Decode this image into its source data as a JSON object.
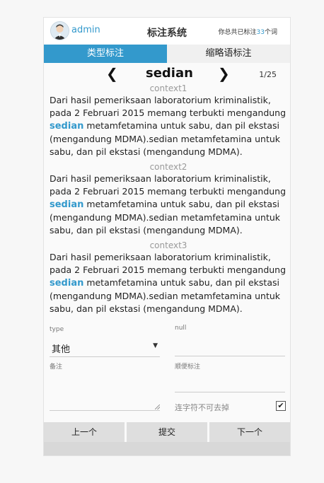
{
  "header": {
    "user": "admin",
    "title": "标注系统",
    "count_prefix": "你总共已标注",
    "count": "33",
    "count_suffix": "个词"
  },
  "tabs": [
    {
      "label": "类型标注",
      "active": true
    },
    {
      "label": "缩略语标注",
      "active": false
    }
  ],
  "word_nav": {
    "prev_icon": "chevron-left-icon",
    "next_icon": "chevron-right-icon",
    "word": "sedian",
    "page": "1/25"
  },
  "contexts": [
    {
      "label": "context1",
      "before": "Dari hasil pemeriksaan laboratorium kriminalistik, pada 2 Februari 2015 memang terbukti mengandung ",
      "highlight": "sedian",
      "after": " metamfetamina untuk sabu, dan pil ekstasi (mengandung MDMA).sedian metamfetamina untuk sabu, dan pil ekstasi (mengandung MDMA)."
    },
    {
      "label": "context2",
      "before": "Dari hasil pemeriksaan laboratorium kriminalistik, pada 2 Februari 2015 memang terbukti mengandung ",
      "highlight": "sedian",
      "after": " metamfetamina untuk sabu, dan pil ekstasi (mengandung MDMA).sedian metamfetamina untuk sabu, dan pil ekstasi (mengandung MDMA)."
    },
    {
      "label": "context3",
      "before": "Dari hasil pemeriksaan laboratorium kriminalistik, pada 2 Februari 2015 memang terbukti mengandung ",
      "highlight": "sedian",
      "after": " metamfetamina untuk sabu, dan pil ekstasi (mengandung MDMA).sedian metamfetamina untuk sabu, dan pil ekstasi (mengandung MDMA)."
    }
  ],
  "form": {
    "type_label": "type",
    "type_value": "其他",
    "null_label": "null",
    "note_label": "备注",
    "extra_label": "顺便标注",
    "hyphen_label": "连字符不可去掉",
    "hyphen_checked": true,
    "check_mark": "✔"
  },
  "buttons": {
    "prev": "上一个",
    "submit": "提交",
    "next": "下一个"
  },
  "colors": {
    "accent": "#3399cc"
  }
}
